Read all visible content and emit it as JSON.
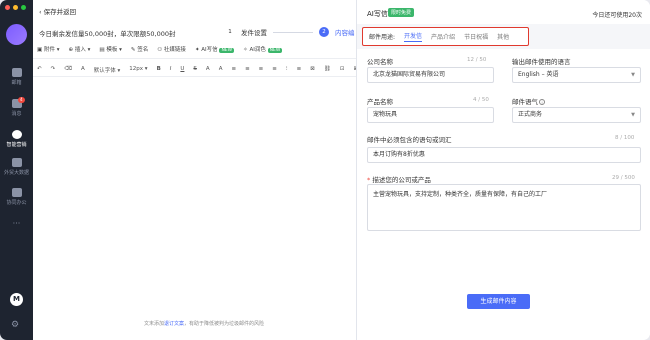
{
  "sidebar": {
    "items": [
      {
        "label": "邮箱",
        "icon": "mail-icon"
      },
      {
        "label": "消息",
        "icon": "message-icon",
        "badge": "4"
      },
      {
        "label": "智能营销",
        "icon": "marketing-icon"
      },
      {
        "label": "外贸大数据",
        "icon": "bigdata-icon"
      },
      {
        "label": "协同办公",
        "icon": "collab-icon"
      }
    ],
    "more": "···"
  },
  "editor": {
    "back_label": "‹ 保存并返回",
    "quota_text": "今日剩余发信量50,000封，单次限额50,000封",
    "steps": [
      {
        "no": "1",
        "label": "发件设置"
      },
      {
        "no": "2",
        "label": "内容编"
      }
    ],
    "toolbar1": [
      "附件",
      "插入",
      "模板",
      "签名",
      "社媒链接",
      "AI写信",
      "AI润色"
    ],
    "new_tag": "NEW",
    "toolbar2": [
      "↶",
      "↷",
      "⌫",
      "A",
      "默认字体",
      "12px",
      "B",
      "I",
      "U",
      "S",
      "A",
      "A",
      "≡",
      "≡",
      "≡",
      "≡",
      "⁝",
      "≡",
      "⊠",
      "⛓",
      "⊡",
      "⊞",
      "⋯"
    ],
    "footer_prefix": "文末添加",
    "footer_link": "退订文案",
    "footer_suffix": "，有助于降低被判为垃圾邮件的风险"
  },
  "panel": {
    "title": "AI写信",
    "free_tag": "限时免费",
    "remain_text": "今日还可使用20次",
    "close": "×",
    "tabs_label": "邮件用途:",
    "tabs": [
      "开发信",
      "产品介绍",
      "节日祝福",
      "其他"
    ],
    "active_tab": "开发信",
    "company_label": "公司名称",
    "company_count": "12 / 50",
    "company_value": "北京龙猫国际贸易有限公司",
    "language_label": "输出邮件使用的语言",
    "language_value": "English – 英语",
    "product_label": "产品名称",
    "product_count": "4 / 50",
    "product_value": "宠物玩具",
    "tone_label": "邮件语气",
    "tone_value": "正式商务",
    "phrase_label": "邮件中必须包含的语句或词汇",
    "phrase_count": "8 / 100",
    "phrase_value": "本月订购有8折优惠",
    "describe_label": "描述您的公司或产品",
    "describe_count": "29 / 500",
    "describe_value": "主营宠物玩具，支持定制，种类齐全，质量有保障，有自己的工厂",
    "generate_label": "生成邮件内容"
  },
  "colors": {
    "accent": "#4a6cf7",
    "rail": "#1e2430",
    "highlight": "#e03a2f",
    "free": "#3bb66b"
  }
}
